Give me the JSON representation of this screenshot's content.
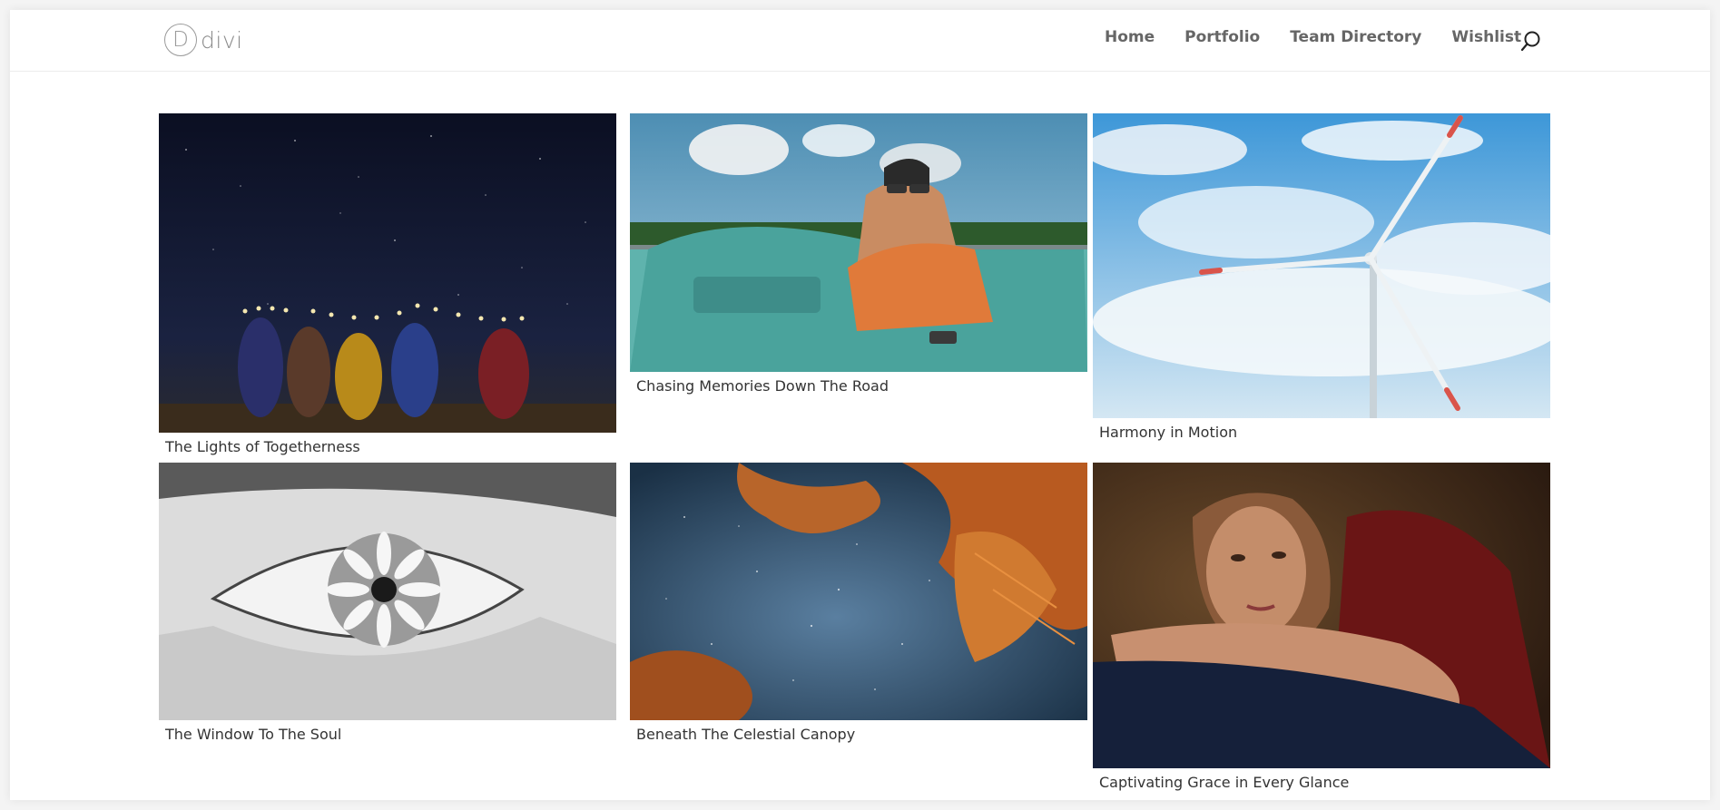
{
  "site": {
    "logo_mark": "D",
    "logo_text": "divi"
  },
  "nav": {
    "items": [
      "Home",
      "Portfolio",
      "Team Directory",
      "Wishlist"
    ],
    "search_icon": "search-icon"
  },
  "gallery": {
    "items": [
      {
        "title": "The Lights of Togetherness",
        "image": "night-sky-group-lights"
      },
      {
        "title": "Chasing Memories Down The Road",
        "image": "man-in-convertible"
      },
      {
        "title": "Harmony in Motion",
        "image": "wind-turbine-sky"
      },
      {
        "title": "The Window To The Soul",
        "image": "eye-with-daisy"
      },
      {
        "title": "Beneath The Celestial Canopy",
        "image": "milky-way-through-trees"
      },
      {
        "title": "Captivating Grace in Every Glance",
        "image": "woman-portrait"
      }
    ]
  },
  "colors": {
    "nav_text": "#666666",
    "caption_text": "#333333",
    "background": "#ffffff"
  }
}
